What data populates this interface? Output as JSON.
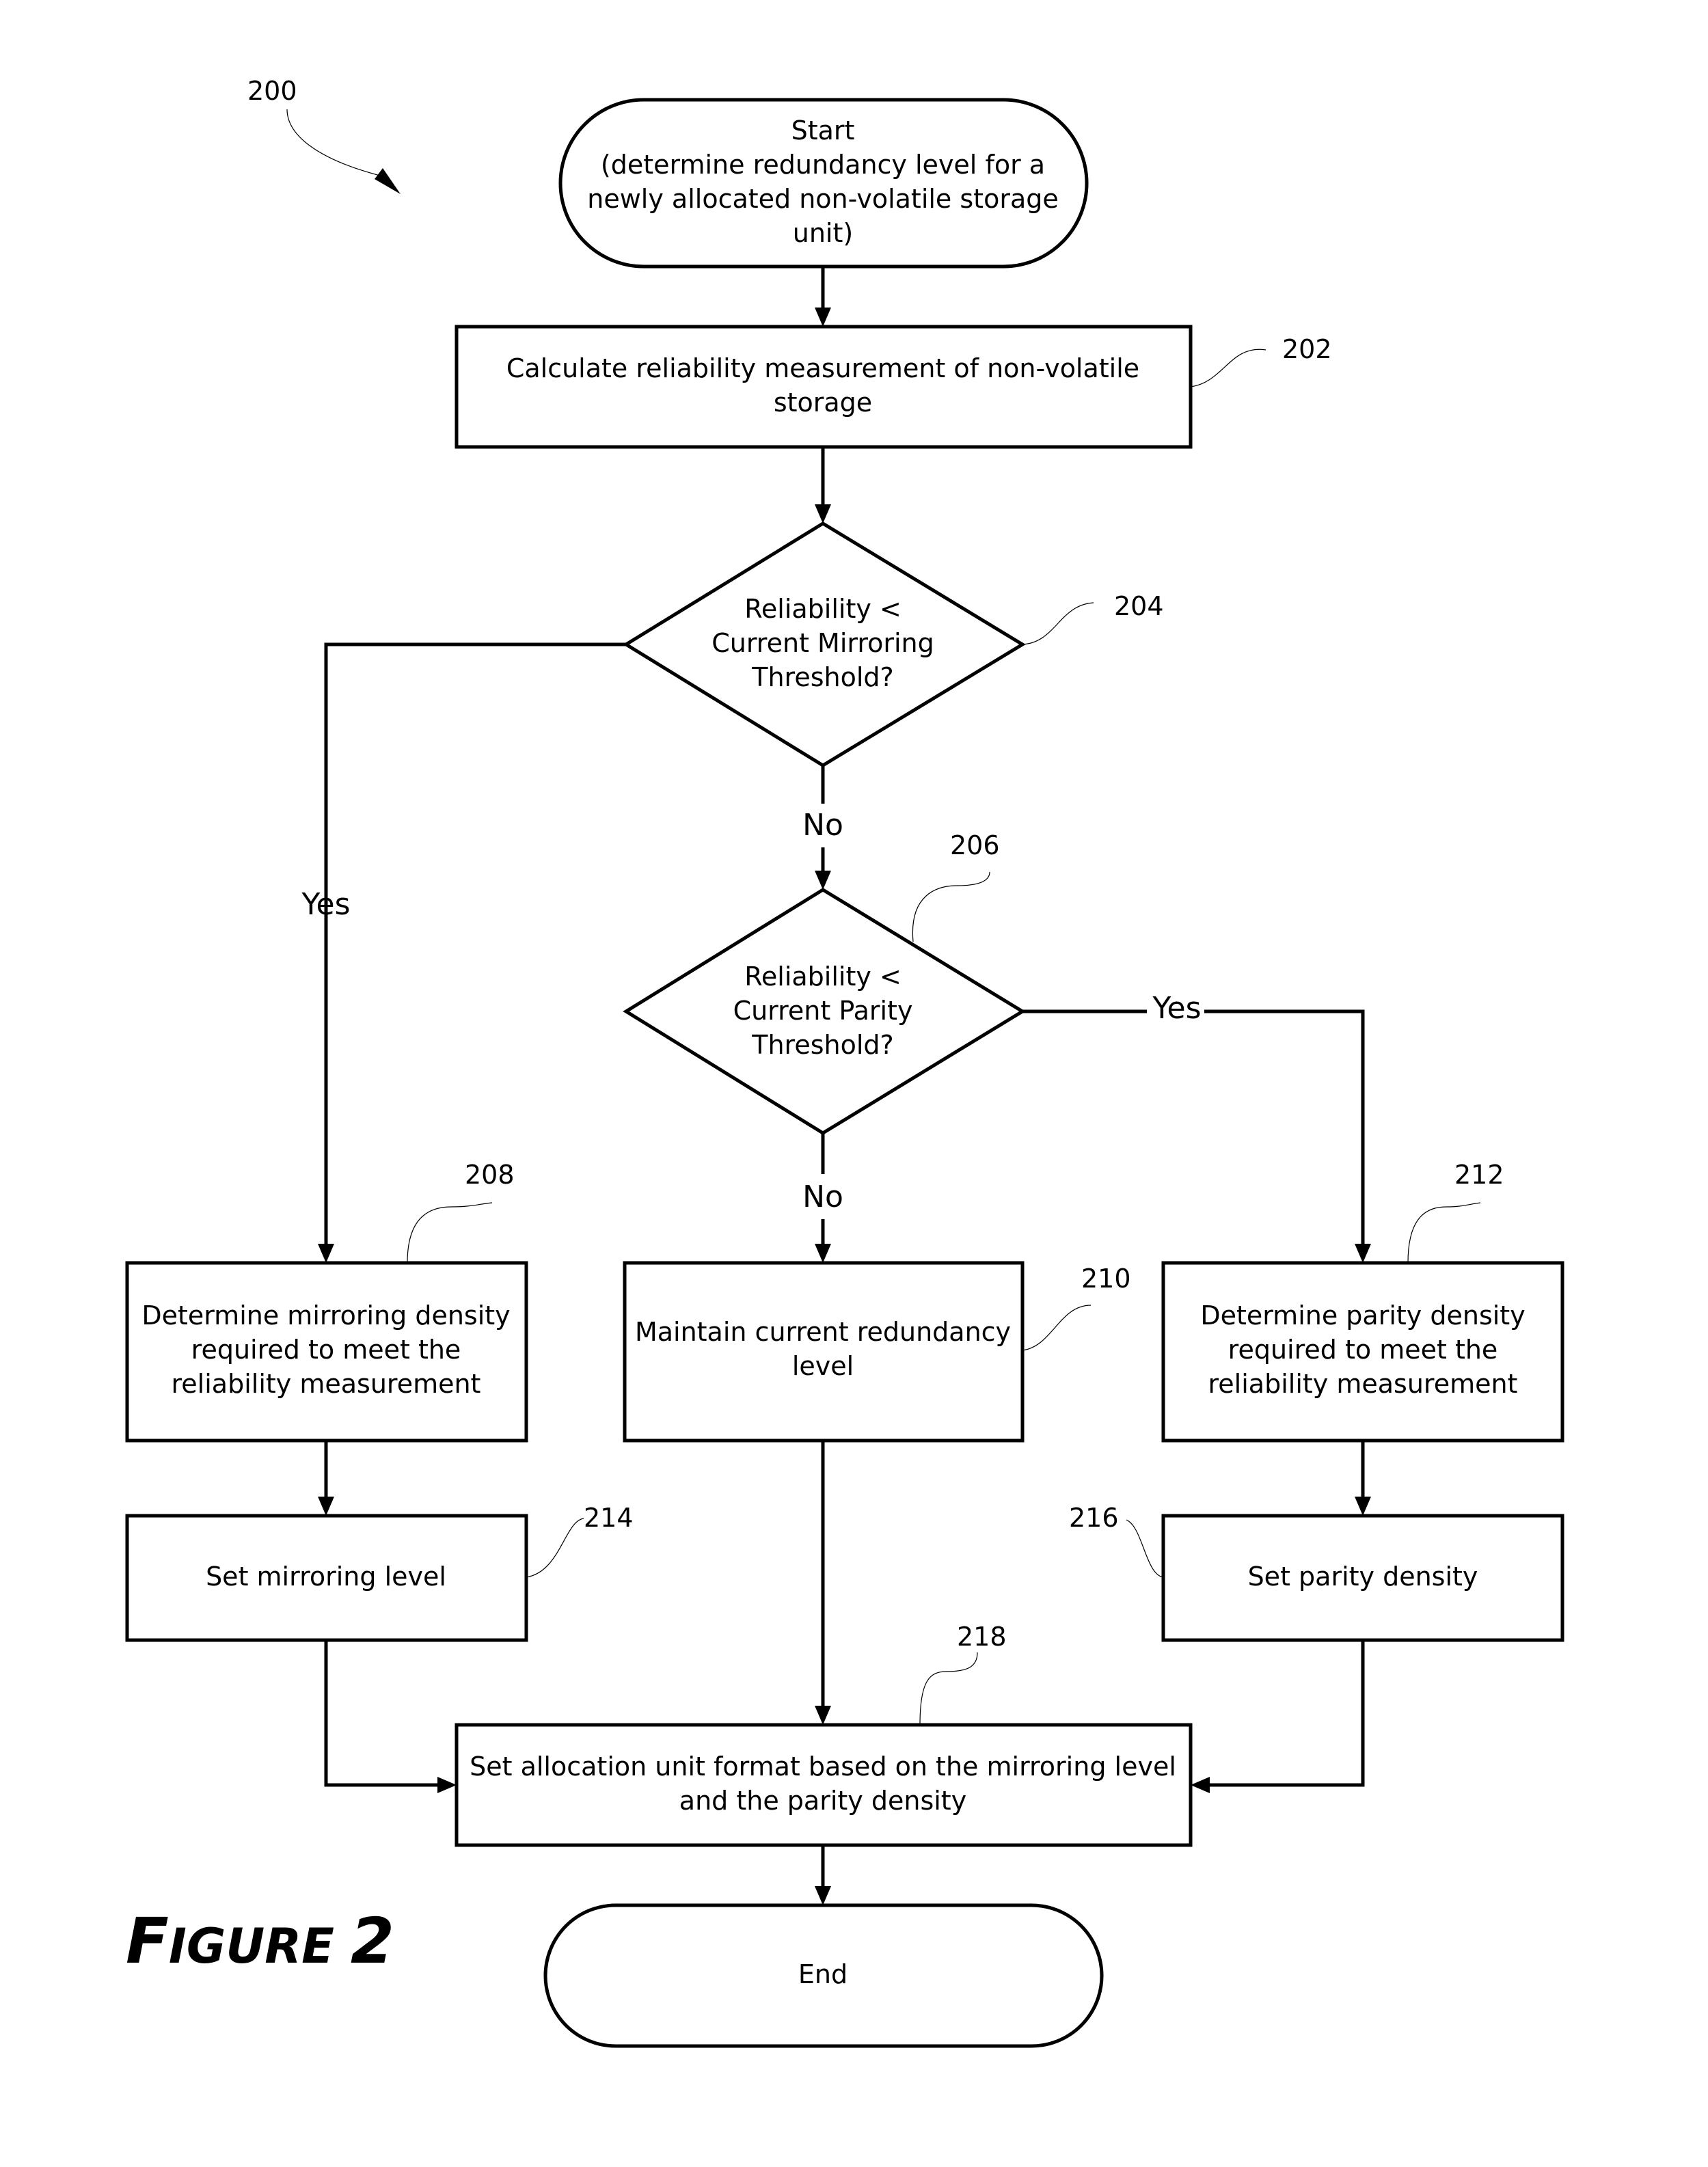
{
  "figure": {
    "reference": "200",
    "caption_first": "F",
    "caption_rest": "IGURE",
    "caption_number": "2"
  },
  "nodes": {
    "start": {
      "type": "terminal",
      "lines": [
        "Start",
        "(determine redundancy level for a",
        "newly allocated non-volatile storage",
        "unit)"
      ]
    },
    "n202": {
      "ref": "202",
      "type": "process",
      "lines": [
        "Calculate reliability measurement of non-volatile",
        "storage"
      ]
    },
    "n204": {
      "ref": "204",
      "type": "decision",
      "lines": [
        "Reliability <",
        "Current Mirroring",
        "Threshold?"
      ]
    },
    "n206": {
      "ref": "206",
      "type": "decision",
      "lines": [
        "Reliability <",
        "Current Parity",
        "Threshold?"
      ]
    },
    "n208": {
      "ref": "208",
      "type": "process",
      "lines": [
        "Determine mirroring density",
        "required to meet the",
        "reliability measurement"
      ]
    },
    "n210": {
      "ref": "210",
      "type": "process",
      "lines": [
        "Maintain current redundancy",
        "level"
      ]
    },
    "n212": {
      "ref": "212",
      "type": "process",
      "lines": [
        "Determine parity density",
        "required to meet the",
        "reliability measurement"
      ]
    },
    "n214": {
      "ref": "214",
      "type": "process",
      "lines": [
        "Set mirroring level"
      ]
    },
    "n216": {
      "ref": "216",
      "type": "process",
      "lines": [
        "Set parity density"
      ]
    },
    "n218": {
      "ref": "218",
      "type": "process",
      "lines": [
        "Set allocation unit format based on the mirroring level",
        "and the parity density"
      ]
    },
    "end": {
      "type": "terminal",
      "lines": [
        "End"
      ]
    }
  },
  "edges": [
    {
      "from": "start",
      "to": "n202",
      "label": ""
    },
    {
      "from": "n202",
      "to": "n204",
      "label": ""
    },
    {
      "from": "n204",
      "to": "n208",
      "label": "Yes"
    },
    {
      "from": "n204",
      "to": "n206",
      "label": "No"
    },
    {
      "from": "n206",
      "to": "n212",
      "label": "Yes"
    },
    {
      "from": "n206",
      "to": "n210",
      "label": "No"
    },
    {
      "from": "n208",
      "to": "n214",
      "label": ""
    },
    {
      "from": "n212",
      "to": "n216",
      "label": ""
    },
    {
      "from": "n214",
      "to": "n218",
      "label": ""
    },
    {
      "from": "n210",
      "to": "n218",
      "label": ""
    },
    {
      "from": "n216",
      "to": "n218",
      "label": ""
    },
    {
      "from": "n218",
      "to": "end",
      "label": ""
    }
  ],
  "edge_labels": {
    "n204_yes": "Yes",
    "n204_no": "No",
    "n206_yes": "Yes",
    "n206_no": "No"
  }
}
